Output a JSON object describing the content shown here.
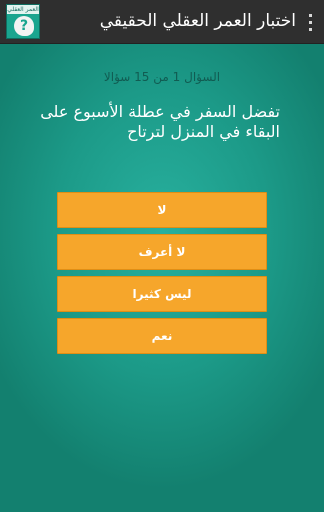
{
  "app_bar": {
    "title": "اختبار العمر العقلي الحقيقي",
    "icon_banner": "العمر العقلي",
    "icon_glyph": "?"
  },
  "quiz": {
    "counter": "السؤال 1 من 15 سؤالا",
    "question": "تفضل السفر في عطلة الأسبوع على البقاء في المنزل لترتاح",
    "answers": [
      "لا",
      "لا أعرف",
      "ليس كثيرا",
      "نعم"
    ]
  },
  "colors": {
    "app_bar": "#2f2f2f",
    "background": "#1f9a8c",
    "answer_button": "#f6a62b",
    "counter_text": "#115c52"
  }
}
